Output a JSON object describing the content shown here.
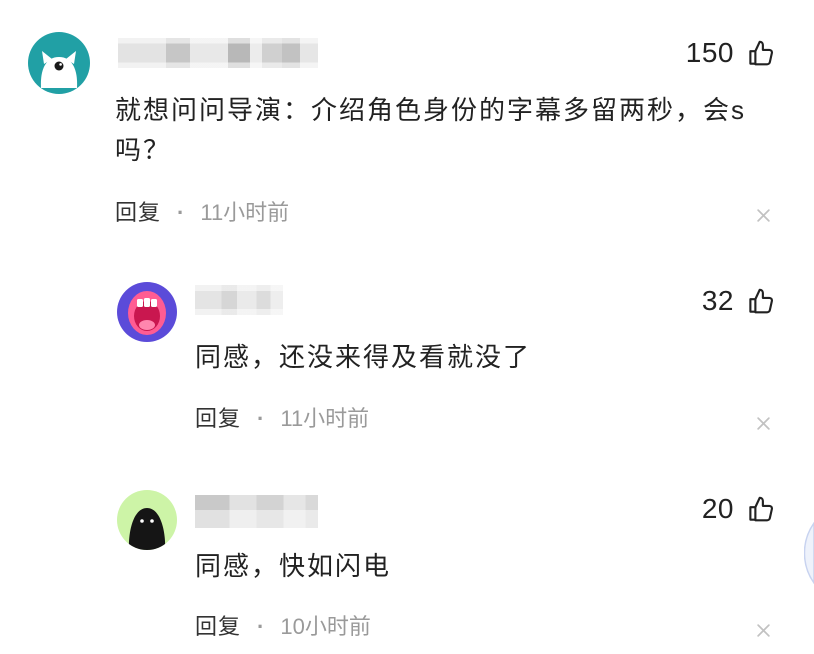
{
  "colors": {
    "background": "#ffffff",
    "text": "#222222",
    "reply-label": "#333333",
    "meta": "#9a9a9a",
    "close": "#c2c2c2",
    "icon": "#222222",
    "fab-fill": "#eef2fb",
    "fab-stroke": "#c8d3f0"
  },
  "comment": {
    "avatar": {
      "icon": "teal-monster-avatar",
      "bg": "#21a0a5"
    },
    "like": {
      "count": "150",
      "icon": "thumbs-up-icon"
    },
    "text": "就想问问导演：介绍角色身份的字幕多留两秒，会s吗？",
    "reply_label": "回复",
    "separator": "·",
    "time": "11小时前",
    "close_icon": "close-icon",
    "replies": [
      {
        "avatar": {
          "icon": "purple-screaming-mouth-avatar",
          "bg": "#5b4bd9"
        },
        "like": {
          "count": "32",
          "icon": "thumbs-up-icon"
        },
        "text": "同感，还没来得及看就没了",
        "reply_label": "回复",
        "separator": "·",
        "time": "11小时前",
        "close_icon": "close-icon"
      },
      {
        "avatar": {
          "icon": "green-black-blob-avatar",
          "bg": "#cdf4a7"
        },
        "like": {
          "count": "20",
          "icon": "thumbs-up-icon"
        },
        "text": "同感，快如闪电",
        "reply_label": "回复",
        "separator": "·",
        "time": "10小时前",
        "close_icon": "close-icon"
      }
    ]
  }
}
